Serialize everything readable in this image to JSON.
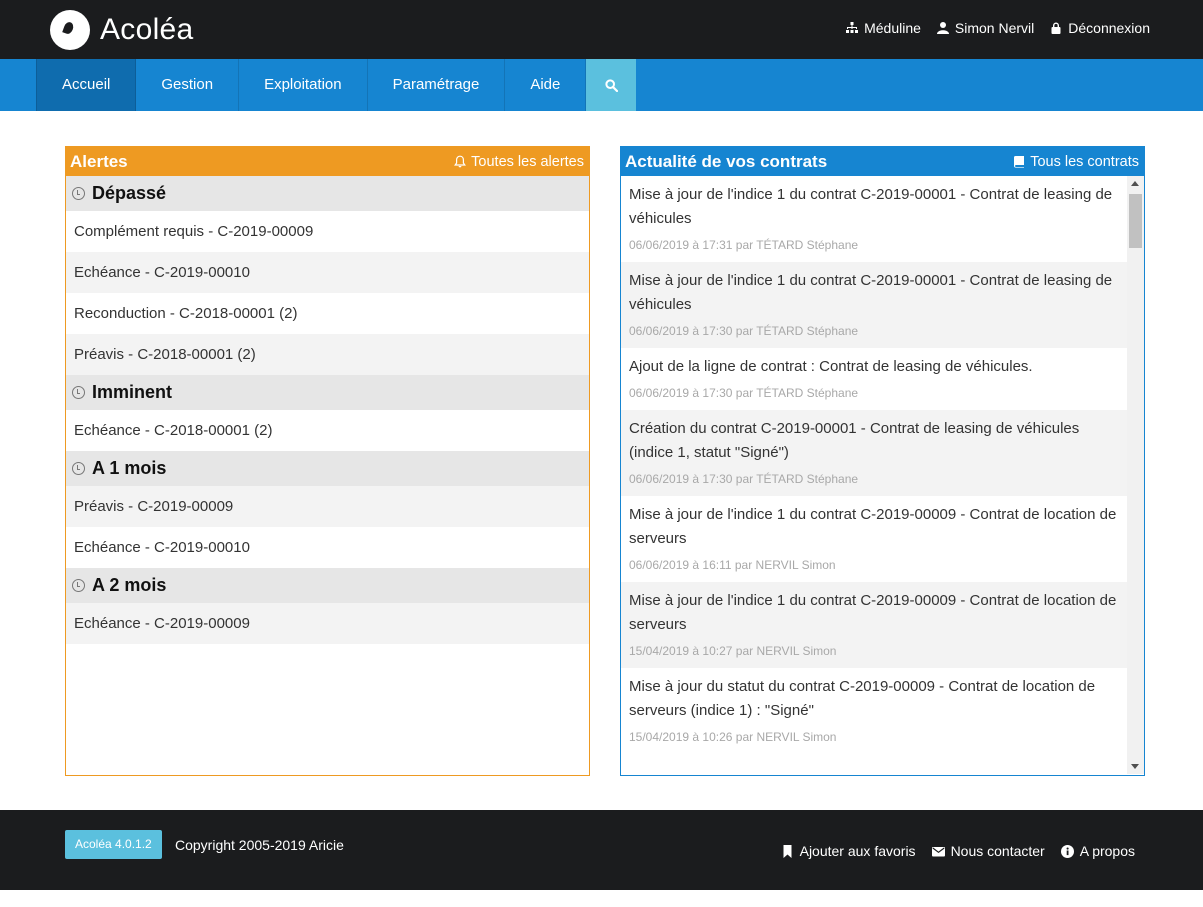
{
  "app": {
    "name": "Acoléa"
  },
  "user_links": [
    {
      "label": "Méduline",
      "icon": "sitemap-icon"
    },
    {
      "label": "Simon Nervil",
      "icon": "user-icon"
    },
    {
      "label": "Déconnexion",
      "icon": "lock-icon"
    }
  ],
  "nav": {
    "items": [
      "Accueil",
      "Gestion",
      "Exploitation",
      "Paramétrage",
      "Aide"
    ],
    "active": "Accueil",
    "search_icon": "search-icon"
  },
  "alerts": {
    "title": "Alertes",
    "link": "Toutes les alertes",
    "accent_color": "#ee9a22",
    "groups": [
      {
        "title": "Dépassé",
        "items": [
          "Complément requis - C-2019-00009",
          "Echéance - C-2019-00010",
          "Reconduction - C-2018-00001 (2)",
          "Préavis - C-2018-00001 (2)"
        ]
      },
      {
        "title": "Imminent",
        "items": [
          "Echéance - C-2018-00001 (2)"
        ]
      },
      {
        "title": "A 1 mois",
        "items": [
          "Préavis - C-2019-00009",
          "Echéance - C-2019-00010"
        ]
      },
      {
        "title": "A 2 mois",
        "items": [
          "Echéance - C-2019-00009"
        ]
      }
    ]
  },
  "news": {
    "title": "Actualité de vos contrats",
    "link": "Tous les contrats",
    "accent_color": "#1685d1",
    "items": [
      {
        "text": "Mise à jour de l'indice 1 du contrat C-2019-00001 - Contrat de leasing de véhicules",
        "meta": "06/06/2019 à 17:31 par TÉTARD Stéphane"
      },
      {
        "text": "Mise à jour de l'indice 1 du contrat C-2019-00001 - Contrat de leasing de véhicules",
        "meta": "06/06/2019 à 17:30 par TÉTARD Stéphane"
      },
      {
        "text": "Ajout de la ligne de contrat : Contrat de leasing de véhicules.",
        "meta": "06/06/2019 à 17:30 par TÉTARD Stéphane"
      },
      {
        "text": "Création du contrat C-2019-00001 - Contrat de leasing de véhicules (indice 1, statut \"Signé\")",
        "meta": "06/06/2019 à 17:30 par TÉTARD Stéphane"
      },
      {
        "text": "Mise à jour de l'indice 1 du contrat C-2019-00009 - Contrat de location de serveurs",
        "meta": "06/06/2019 à 16:11 par NERVIL Simon"
      },
      {
        "text": "Mise à jour de l'indice 1 du contrat C-2019-00009 - Contrat de location de serveurs",
        "meta": "15/04/2019 à 10:27 par NERVIL Simon"
      },
      {
        "text": "Mise à jour du statut du contrat C-2019-00009 - Contrat de location de serveurs (indice 1) : \"Signé\"",
        "meta": "15/04/2019 à 10:26 par NERVIL Simon"
      }
    ]
  },
  "footer": {
    "version": "Acoléa  4.0.1.2",
    "copyright": "Copyright 2005-2019 Aricie",
    "links": [
      {
        "label": "Ajouter aux favoris",
        "icon": "bookmark-icon"
      },
      {
        "label": "Nous contacter",
        "icon": "envelope-icon"
      },
      {
        "label": "A propos",
        "icon": "info-icon"
      }
    ]
  }
}
